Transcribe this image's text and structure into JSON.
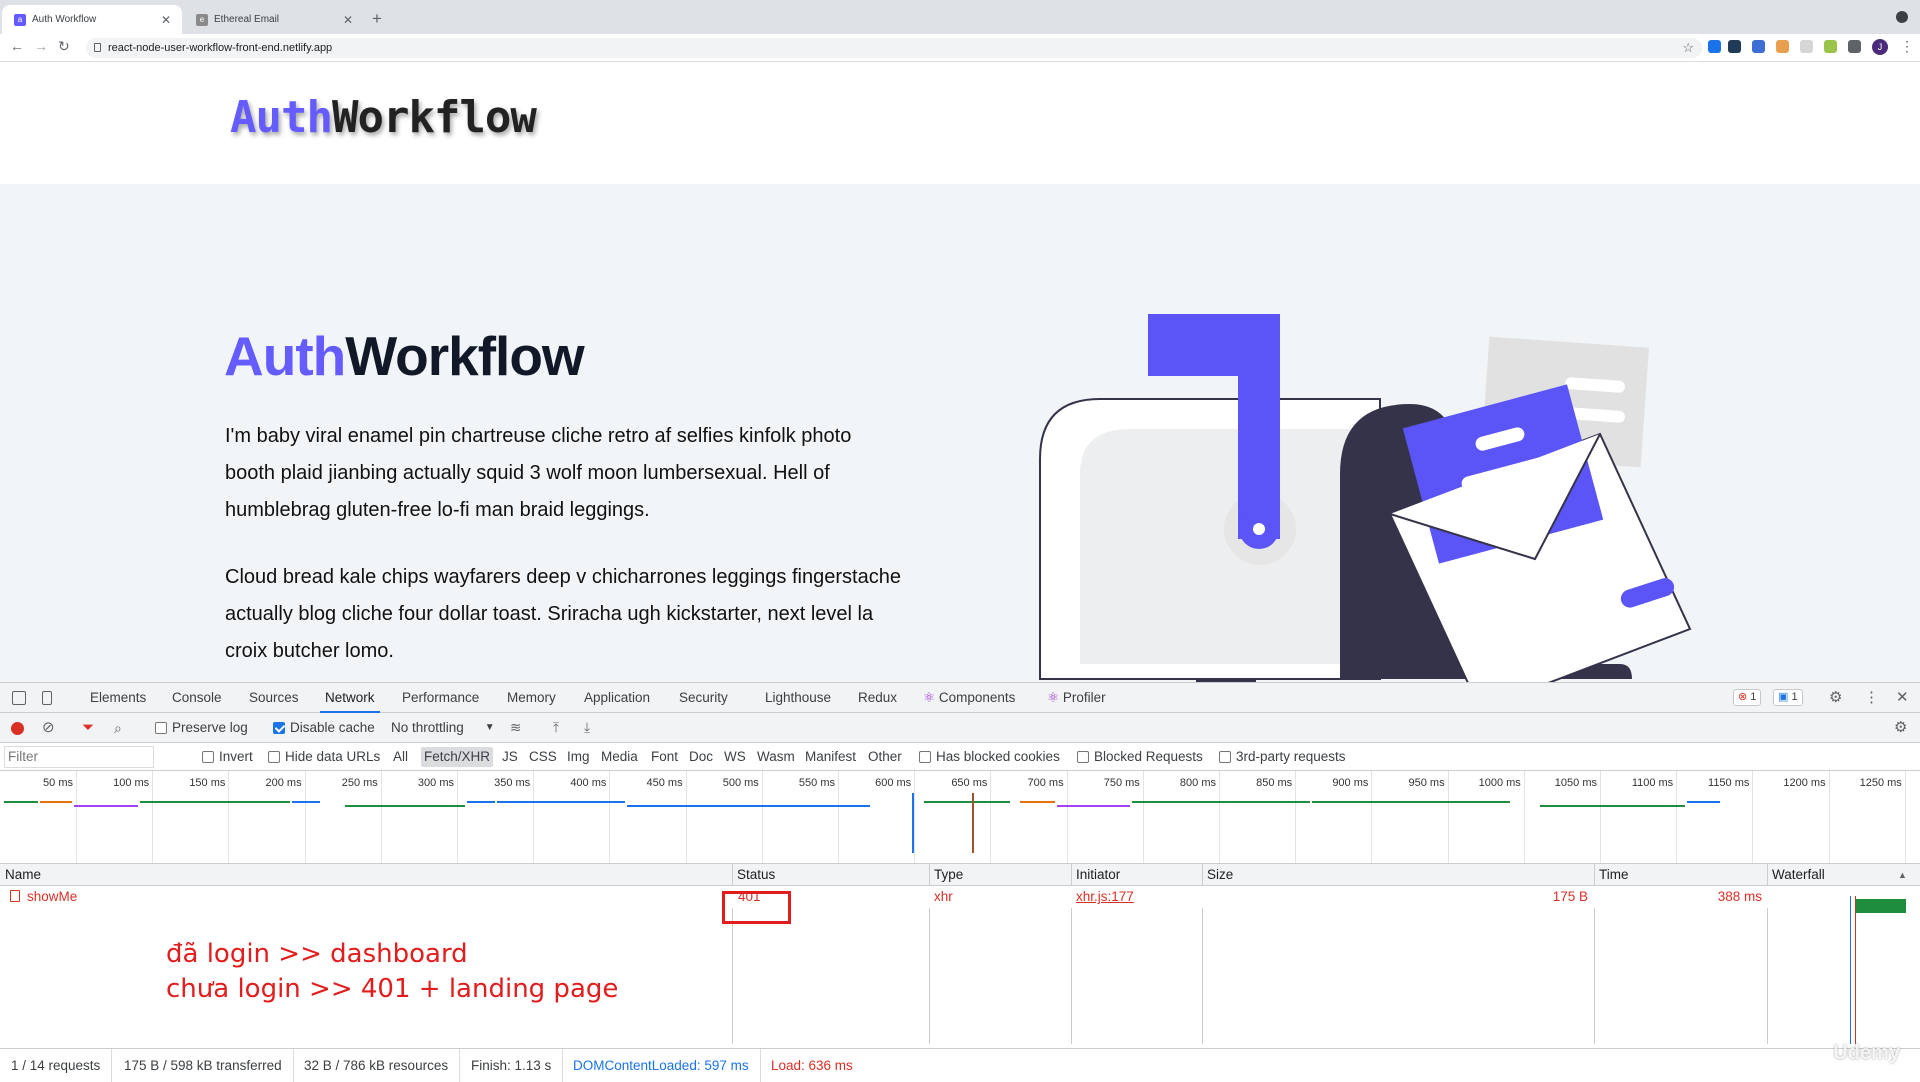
{
  "browser": {
    "tabs": [
      {
        "title": "Auth Workflow",
        "favicon": "tab-favicon-auth"
      },
      {
        "title": "Ethereal Email",
        "favicon": "tab-favicon-ethereal"
      }
    ],
    "new_tab": "+",
    "url": "react-node-user-workflow-front-end.netlify.app",
    "avatar_letter": "J"
  },
  "page": {
    "logo": {
      "part1": "Auth",
      "part2": "Workflow"
    },
    "hero_title": {
      "part1": "Auth",
      "part2": "Workflow"
    },
    "paragraph1": "I'm baby viral enamel pin chartreuse cliche retro af selfies kinfolk photo booth plaid jianbing actually squid 3 wolf moon lumbersexual. Hell of humblebrag gluten-free lo-fi man braid leggings.",
    "paragraph2": "Cloud bread kale chips wayfarers deep v chicharrones leggings fingerstache actually blog cliche four dollar toast. Sriracha ugh kickstarter, next level la croix butcher lomo.",
    "colors": {
      "primary": "#645cff",
      "dark": "#222222",
      "hero_bg": "#f1f5f8"
    }
  },
  "devtools": {
    "tabs": [
      "Elements",
      "Console",
      "Sources",
      "Network",
      "Performance",
      "Memory",
      "Application",
      "Security",
      "Lighthouse",
      "Redux",
      "Components",
      "Profiler"
    ],
    "selected_tab": "Network",
    "error_count": "1",
    "message_count": "1",
    "toolbar": {
      "preserve_log": "Preserve log",
      "disable_cache": "Disable cache",
      "throttling": "No throttling"
    },
    "filter_bar": {
      "placeholder": "Filter",
      "invert": "Invert",
      "hide_data_urls": "Hide data URLs",
      "types": [
        "All",
        "Fetch/XHR",
        "JS",
        "CSS",
        "Img",
        "Media",
        "Font",
        "Doc",
        "WS",
        "Wasm",
        "Manifest",
        "Other"
      ],
      "selected_type": "Fetch/XHR",
      "has_blocked_cookies": "Has blocked cookies",
      "blocked_requests": "Blocked Requests",
      "third_party": "3rd-party requests"
    },
    "timeline_ticks": [
      "50 ms",
      "100 ms",
      "150 ms",
      "200 ms",
      "250 ms",
      "300 ms",
      "350 ms",
      "400 ms",
      "450 ms",
      "500 ms",
      "550 ms",
      "600 ms",
      "650 ms",
      "700 ms",
      "750 ms",
      "800 ms",
      "850 ms",
      "900 ms",
      "950 ms",
      "1000 ms",
      "1050 ms",
      "1100 ms",
      "1150 ms",
      "1200 ms",
      "1250 ms"
    ],
    "columns": [
      "Name",
      "Status",
      "Type",
      "Initiator",
      "Size",
      "Time",
      "Waterfall"
    ],
    "rows": [
      {
        "name": "showMe",
        "status": "401",
        "type": "xhr",
        "initiator": "xhr.js:177",
        "size": "175 B",
        "time": "388 ms"
      }
    ],
    "annotation": {
      "line1": "đã login >> dashboard",
      "line2": "chưa login >> 401 + landing page"
    },
    "summary": {
      "requests": "1 / 14 requests",
      "transferred": "175 B / 598 kB transferred",
      "resources": "32 B / 786 kB resources",
      "finish": "Finish: 1.13 s",
      "dom_content_loaded": "DOMContentLoaded: 597 ms",
      "load": "Load: 636 ms"
    }
  },
  "watermark": "Udemy"
}
